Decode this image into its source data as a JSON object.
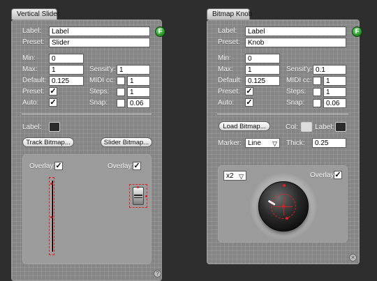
{
  "left_panel": {
    "title": "Vertical Slider",
    "f_button": "F",
    "label_caption": "Label:",
    "label_value": "Label",
    "preset_caption": "Preset:",
    "preset_value": "Slider",
    "min_caption": "Min:",
    "min_value": "0",
    "max_caption": "Max:",
    "max_value": "1",
    "default_caption": "Default:",
    "default_value": "0.125",
    "preset_check_caption": "Preset:",
    "auto_caption": "Auto:",
    "sensitivity_caption": "Sensit'y:",
    "sensitivity_value": "1",
    "midi_caption": "MIDI cc:",
    "midi_value": "1",
    "steps_caption": "Steps:",
    "steps_value": "1",
    "snap_caption": "Snap:",
    "snap_value": "0.06",
    "label_color_caption": "Label:",
    "track_bitmap_button": "Track Bitmap...",
    "slider_bitmap_button": "Slider Bitmap...",
    "overlay1_caption": "Overlay:",
    "overlay2_caption": "Overlay:",
    "label_color": "#2b2b2b"
  },
  "right_panel": {
    "title": "Bitmap Knob",
    "f_button": "F",
    "label_caption": "Label:",
    "label_value": "Label",
    "preset_caption": "Preset:",
    "preset_value": "Knob",
    "min_caption": "Min:",
    "min_value": "0",
    "max_caption": "Max:",
    "max_value": "1",
    "default_caption": "Default:",
    "default_value": "0.125",
    "preset_check_caption": "Preset:",
    "auto_caption": "Auto:",
    "sensitivity_caption": "Sensit'y:",
    "sensitivity_value": "0.1",
    "midi_caption": "MIDI cc:",
    "midi_value": "1",
    "steps_caption": "Steps:",
    "steps_value": "1",
    "snap_caption": "Snap:",
    "snap_value": "0.06",
    "load_bitmap_button": "Load Bitmap...",
    "col_caption": "Col:",
    "label_color_caption": "Label:",
    "marker_caption": "Marker:",
    "marker_value": "Line",
    "thick_caption": "Thick:",
    "thick_value": "0.25",
    "zoom_value": "x2",
    "overlay_caption": "Overlay:",
    "col_color": "#dcdcdc",
    "label_color": "#2b2b2b"
  },
  "checkmark": "✓",
  "dropdown_arrow": "▽",
  "colors": {
    "background": "#2e2e2e",
    "panel": "#858585",
    "accent_green": "#1b8a1b",
    "marker_red": "#e02020"
  }
}
